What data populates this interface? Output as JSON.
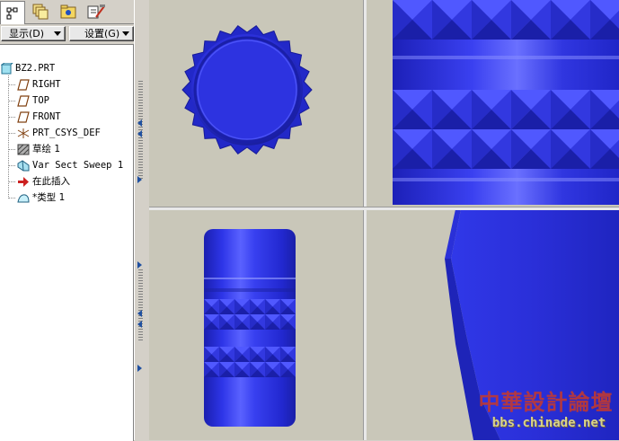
{
  "toolbar_tabs": [
    {
      "icon": "model-tree-icon",
      "active": true
    },
    {
      "icon": "layers-icon",
      "active": false
    },
    {
      "icon": "folder-icon",
      "active": false
    },
    {
      "icon": "tools-icon",
      "active": false
    }
  ],
  "menus": {
    "show": "显示(D)",
    "settings": "设置(G)"
  },
  "tree": {
    "root": "BZ2.PRT",
    "items": [
      {
        "label": "RIGHT",
        "icon": "datum-plane-icon"
      },
      {
        "label": "TOP",
        "icon": "datum-plane-icon"
      },
      {
        "label": "FRONT",
        "icon": "datum-plane-icon"
      },
      {
        "label": "PRT_CSYS_DEF",
        "icon": "csys-icon"
      },
      {
        "label": "草绘 1",
        "icon": "sketch-icon"
      },
      {
        "label": "Var Sect Sweep 1",
        "icon": "sweep-icon"
      },
      {
        "label": "在此插入",
        "icon": "insert-here-arrow-icon"
      },
      {
        "label": "*类型 1",
        "icon": "surface-icon"
      }
    ]
  },
  "colors": {
    "model_blue": "#2a2fd8",
    "viewport_bg": "#c9c7b9",
    "insert_arrow": "#cc2020",
    "watermark_red": "#c93a2a"
  },
  "watermark": {
    "title": "中華設計論壇",
    "url": "bbs.chinade.net"
  }
}
